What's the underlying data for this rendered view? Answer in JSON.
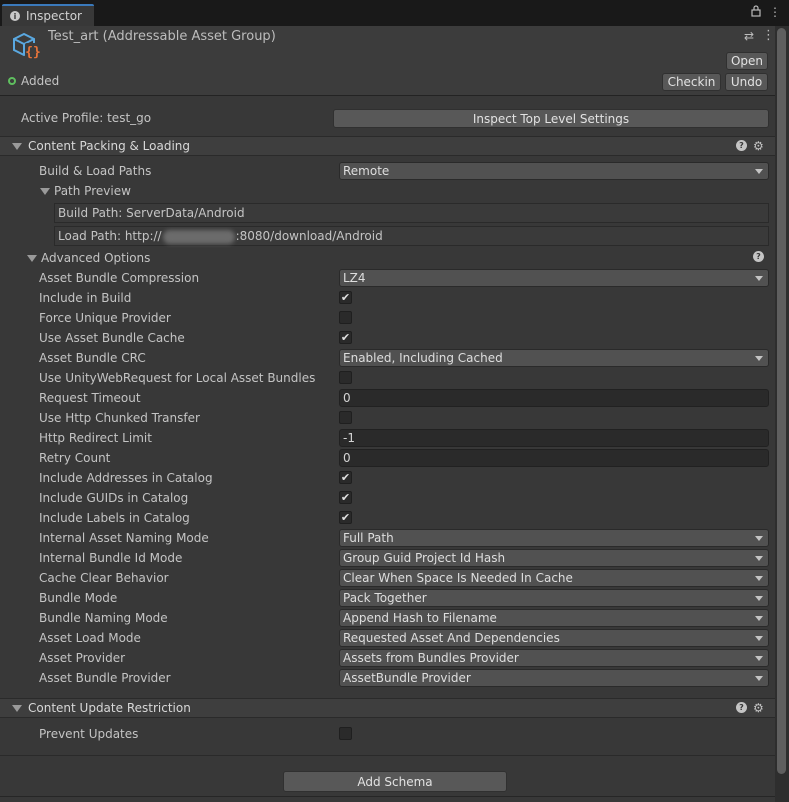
{
  "tab": {
    "label": "Inspector",
    "icon": "info-icon"
  },
  "window_icons": [
    "lock-icon",
    "more-menu-icon"
  ],
  "header": {
    "title": "Test_art (Addressable Asset Group)",
    "status": "Added",
    "open_label": "Open",
    "checkin_label": "Checkin",
    "undo_label": "Undo"
  },
  "profile": {
    "label": "Active Profile: test_go",
    "inspect_button": "Inspect Top Level Settings"
  },
  "packing": {
    "title": "Content Packing & Loading",
    "build_load_label": "Build & Load Paths",
    "build_load_value": "Remote",
    "path_preview_label": "Path Preview",
    "build_path": "Build Path: ServerData/Android",
    "load_path_prefix": "Load Path: http://",
    "load_path_suffix": ":8080/download/Android",
    "advanced_label": "Advanced Options",
    "rows": [
      {
        "label": "Asset Bundle Compression",
        "type": "dropdown",
        "value": "LZ4"
      },
      {
        "label": "Include in Build",
        "type": "checkbox",
        "checked": true
      },
      {
        "label": "Force Unique Provider",
        "type": "checkbox",
        "checked": false
      },
      {
        "label": "Use Asset Bundle Cache",
        "type": "checkbox",
        "checked": true
      },
      {
        "label": "Asset Bundle CRC",
        "type": "dropdown",
        "value": "Enabled, Including Cached"
      },
      {
        "label": "Use UnityWebRequest for Local Asset Bundles",
        "type": "checkbox",
        "checked": false
      },
      {
        "label": "Request Timeout",
        "type": "field",
        "value": "0"
      },
      {
        "label": "Use Http Chunked Transfer",
        "type": "checkbox",
        "checked": false
      },
      {
        "label": "Http Redirect Limit",
        "type": "field",
        "value": "-1"
      },
      {
        "label": "Retry Count",
        "type": "field",
        "value": "0"
      },
      {
        "label": "Include Addresses in Catalog",
        "type": "checkbox",
        "checked": true
      },
      {
        "label": "Include GUIDs in Catalog",
        "type": "checkbox",
        "checked": true
      },
      {
        "label": "Include Labels in Catalog",
        "type": "checkbox",
        "checked": true
      },
      {
        "label": "Internal Asset Naming Mode",
        "type": "dropdown",
        "value": "Full Path"
      },
      {
        "label": "Internal Bundle Id Mode",
        "type": "dropdown",
        "value": "Group Guid Project Id Hash"
      },
      {
        "label": "Cache Clear Behavior",
        "type": "dropdown",
        "value": "Clear When Space Is Needed In Cache"
      },
      {
        "label": "Bundle Mode",
        "type": "dropdown",
        "value": "Pack Together"
      },
      {
        "label": "Bundle Naming Mode",
        "type": "dropdown",
        "value": "Append Hash to Filename"
      },
      {
        "label": "Asset Load Mode",
        "type": "dropdown",
        "value": "Requested Asset And Dependencies"
      },
      {
        "label": "Asset Provider",
        "type": "dropdown",
        "value": "Assets from Bundles Provider"
      },
      {
        "label": "Asset Bundle Provider",
        "type": "dropdown",
        "value": "AssetBundle Provider"
      }
    ]
  },
  "update": {
    "title": "Content Update Restriction",
    "prevent_label": "Prevent Updates",
    "prevent_checked": false
  },
  "add_schema_label": "Add Schema",
  "colors": {
    "panel": "#383838",
    "accent": "#3a79bb",
    "added": "#5fbf5f",
    "group_icon_blue": "#5aa8e0",
    "group_icon_orange": "#e8743a"
  }
}
